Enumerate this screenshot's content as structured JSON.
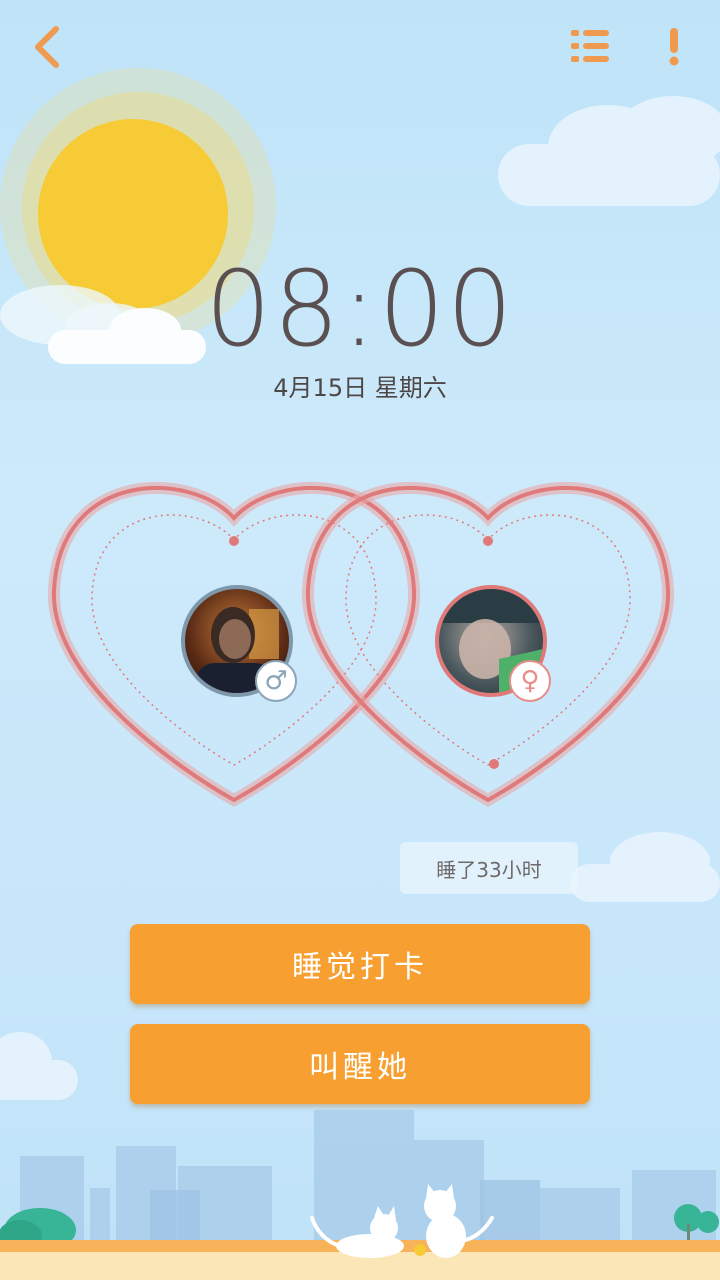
{
  "header": {
    "back_icon": "chevron-left-icon",
    "list_icon": "list-icon",
    "alert_icon": "exclamation-icon"
  },
  "clock": {
    "time": "08:00",
    "date": "4月15日  星期六"
  },
  "couple": {
    "male": {
      "badge_symbol": "♂",
      "badge_color": "#8aa4b8"
    },
    "female": {
      "badge_symbol": "♀",
      "badge_color": "#e88c8c"
    }
  },
  "sleep_status": "睡了33小时",
  "buttons": {
    "checkin": "睡觉打卡",
    "wake": "叫醒她"
  },
  "colors": {
    "accent": "#f7a031",
    "heart": "#e07a7a",
    "sun": "#f6cb35",
    "text": "#5a5051"
  }
}
